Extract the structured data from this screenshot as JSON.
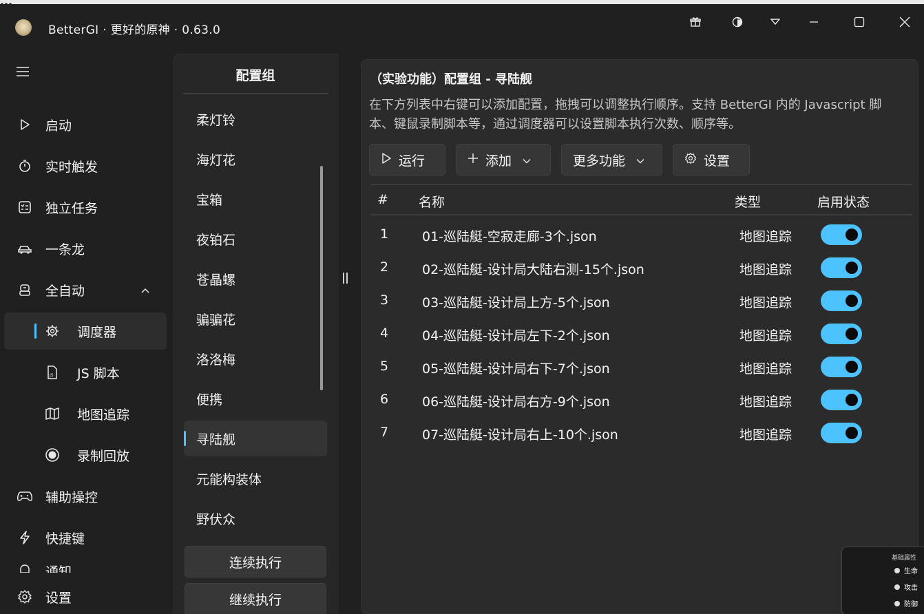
{
  "background": {
    "partial_text": "…"
  },
  "titlebar": {
    "title": "BetterGI · 更好的原神 · 0.63.0",
    "buttons": [
      "gift-icon",
      "theme-icon",
      "dropdown-icon",
      "minimize-icon",
      "maximize-icon",
      "close-icon"
    ]
  },
  "nav": {
    "items": [
      {
        "label": "启动",
        "icon": "play-icon"
      },
      {
        "label": "实时触发",
        "icon": "timer-icon"
      },
      {
        "label": "独立任务",
        "icon": "checklist-icon"
      },
      {
        "label": "一条龙",
        "icon": "car-icon"
      },
      {
        "label": "全自动",
        "icon": "robot-icon"
      },
      {
        "label": "调度器",
        "icon": "chip-icon"
      },
      {
        "label": "JS 脚本",
        "icon": "js-file-icon"
      },
      {
        "label": "地图追踪",
        "icon": "map-icon"
      },
      {
        "label": "录制回放",
        "icon": "record-icon"
      },
      {
        "label": "辅助操控",
        "icon": "gamepad-icon"
      },
      {
        "label": "快捷键",
        "icon": "lightning-icon"
      },
      {
        "label": "通知",
        "icon": "bell-icon"
      },
      {
        "label": "设置",
        "icon": "gear-icon"
      }
    ]
  },
  "groups": {
    "header": "配置组",
    "items": [
      "柔灯铃",
      "海灯花",
      "宝箱",
      "夜铂石",
      "苍晶螺",
      "骗骗花",
      "洛洛梅",
      "便携",
      "寻陆舰",
      "元能构装体",
      "野伏众"
    ],
    "active": "寻陆舰",
    "buttons": {
      "continuous": "连续执行",
      "resume": "继续执行"
    }
  },
  "main": {
    "title": "（实验功能）配置组 - 寻陆舰",
    "description": "在下方列表中右键可以添加配置，拖拽可以调整执行顺序。支持 BetterGI 内的 Javascript 脚本、键鼠录制脚本等，通过调度器可以设置脚本执行次数、顺序等。",
    "toolbar": {
      "run": "运行",
      "add": "添加",
      "more": "更多功能",
      "settings": "设置"
    },
    "table": {
      "headers": {
        "index": "#",
        "name": "名称",
        "type": "类型",
        "enabled": "启用状态"
      },
      "rows": [
        {
          "index": "1",
          "name": "01-巡陆艇-空寂走廊-3个.json",
          "type": "地图追踪",
          "enabled": true
        },
        {
          "index": "2",
          "name": "02-巡陆艇-设计局大陆右测-15个.json",
          "type": "地图追踪",
          "enabled": true
        },
        {
          "index": "3",
          "name": "03-巡陆艇-设计局上方-5个.json",
          "type": "地图追踪",
          "enabled": true
        },
        {
          "index": "4",
          "name": "04-巡陆艇-设计局左下-2个.json",
          "type": "地图追踪",
          "enabled": true
        },
        {
          "index": "5",
          "name": "05-巡陆艇-设计局右下-7个.json",
          "type": "地图追踪",
          "enabled": true
        },
        {
          "index": "6",
          "name": "06-巡陆艇-设计局右方-9个.json",
          "type": "地图追踪",
          "enabled": true
        },
        {
          "index": "7",
          "name": "07-巡陆艇-设计局右上-10个.json",
          "type": "地图追踪",
          "enabled": true
        }
      ]
    }
  },
  "overlay": {
    "title": "基础属性",
    "rows": [
      "生命",
      "攻击",
      "防御"
    ]
  },
  "colors": {
    "accent": "#4cc2ff",
    "background": "#202020",
    "card": "#2b2b2b"
  }
}
